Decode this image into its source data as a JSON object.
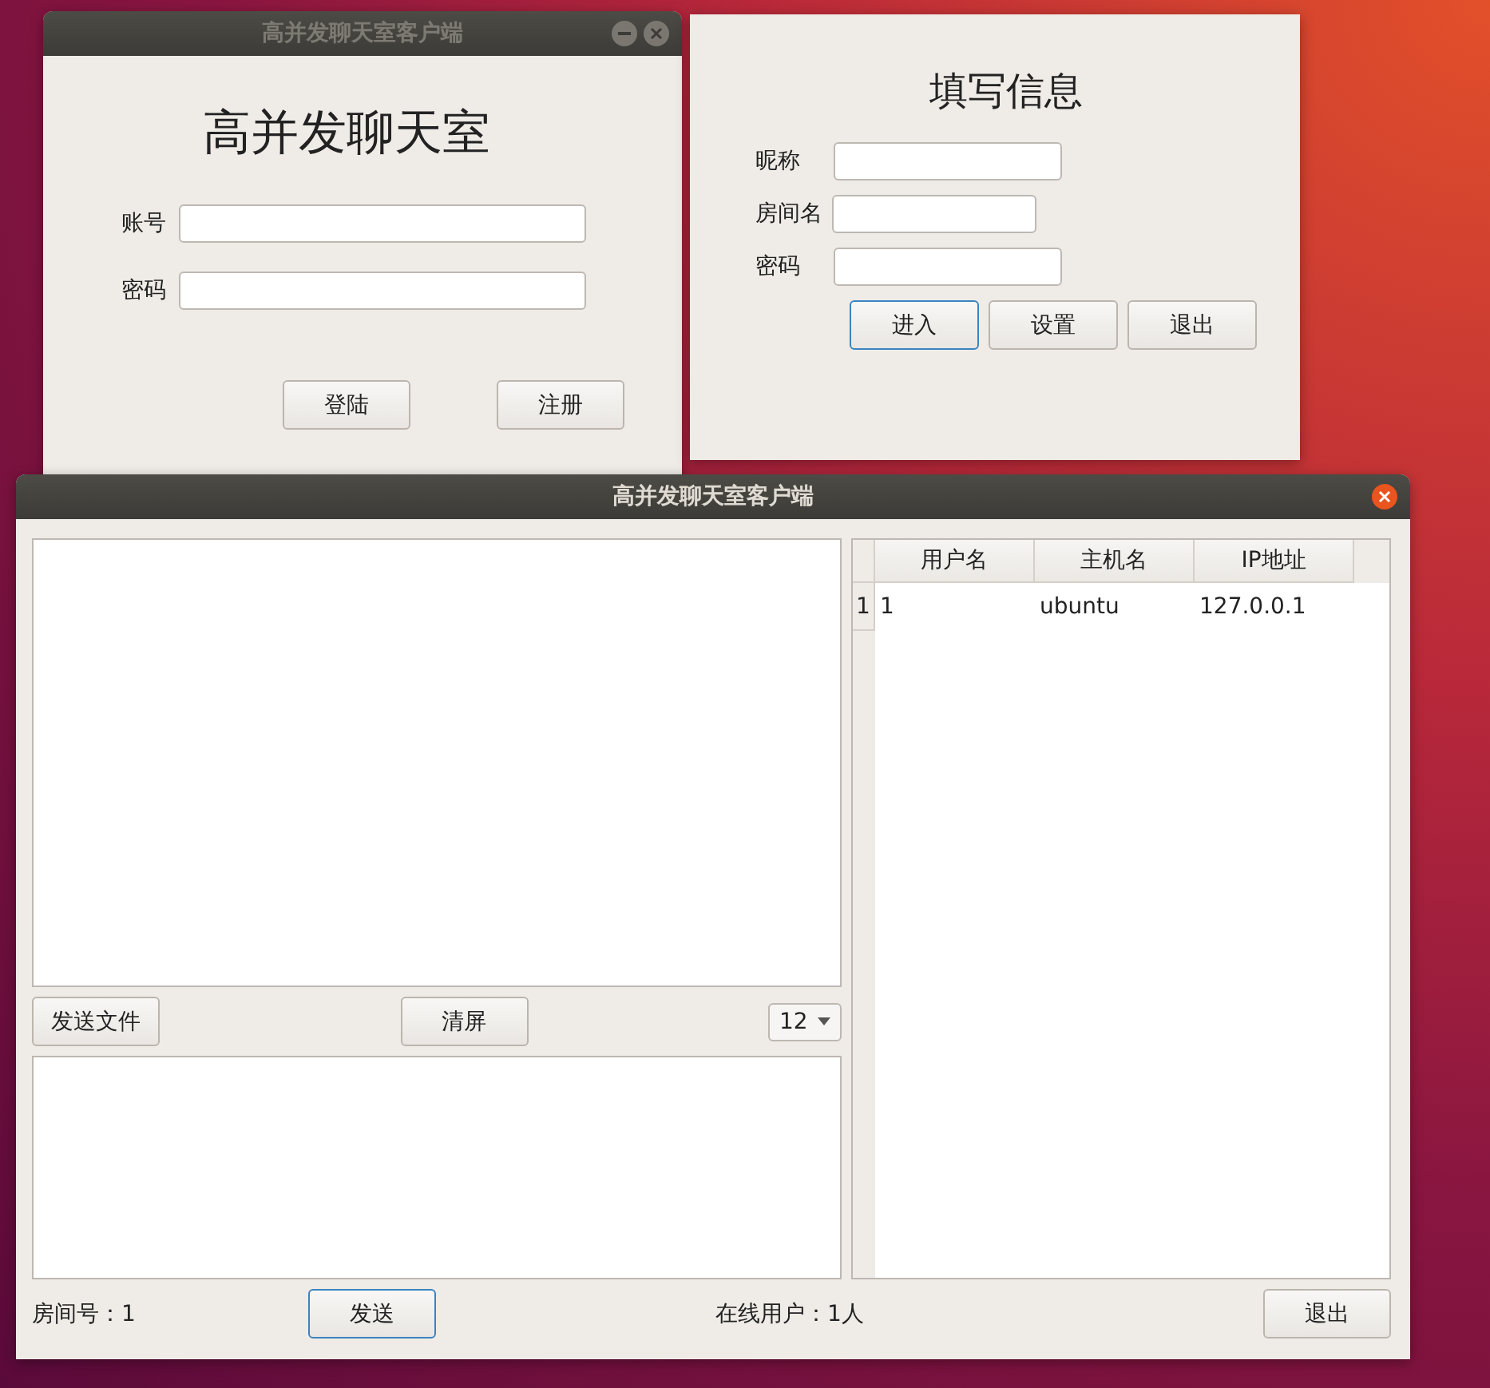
{
  "login_window": {
    "title": "高并发聊天室客户端",
    "active": false,
    "heading": "高并发聊天室",
    "fields": [
      {
        "label": "账号"
      },
      {
        "label": "密码"
      }
    ],
    "buttons": [
      {
        "label": "登陆",
        "focused": false
      },
      {
        "label": "注册",
        "focused": false
      }
    ]
  },
  "info_window": {
    "heading": "填写信息",
    "fields": [
      {
        "label": "昵称"
      },
      {
        "label": "房间名"
      },
      {
        "label": "密码"
      }
    ],
    "buttons": [
      {
        "label": "进入",
        "focused": true
      },
      {
        "label": "设置",
        "focused": false
      },
      {
        "label": "退出",
        "focused": false
      }
    ]
  },
  "chat_window": {
    "title": "高并发聊天室客户端",
    "active": true,
    "toolbar": {
      "file_button": "发送文件",
      "clear_button": "清屏",
      "font_size": "12"
    },
    "room_label": "房间号：1",
    "send_button": {
      "label": "发送",
      "focused": true
    },
    "online_label": "在线用户：1人",
    "exit_button": {
      "label": "退出",
      "focused": false
    },
    "user_table": {
      "columns": [
        "用户名",
        "主机名",
        "IP地址"
      ],
      "rows": [
        {
          "number": "1",
          "cells": [
            "1",
            "ubuntu",
            "127.0.0.1"
          ]
        }
      ]
    }
  }
}
